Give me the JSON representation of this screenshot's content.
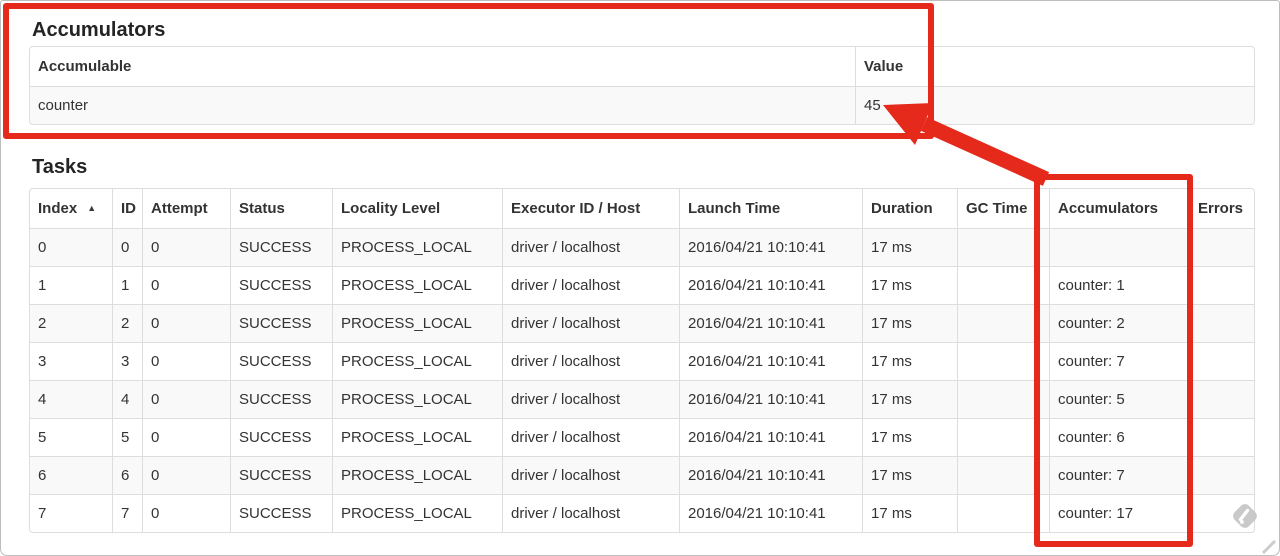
{
  "colors": {
    "annotation_red": "#e5291b",
    "row_stripe": "#f9f9f9",
    "table_border": "#dddddd",
    "text": "#333333"
  },
  "accumulators_section": {
    "heading": "Accumulators",
    "columns": [
      "Accumulable",
      "Value"
    ],
    "rows": [
      {
        "accumulable": "counter",
        "value": "45"
      }
    ]
  },
  "tasks_section": {
    "heading": "Tasks",
    "sort_indicator": "▲",
    "columns": [
      "Index",
      "ID",
      "Attempt",
      "Status",
      "Locality Level",
      "Executor ID / Host",
      "Launch Time",
      "Duration",
      "GC Time",
      "Accumulators",
      "Errors"
    ],
    "rows": [
      {
        "index": "0",
        "id": "0",
        "attempt": "0",
        "status": "SUCCESS",
        "locality_level": "PROCESS_LOCAL",
        "executor_id_host": "driver / localhost",
        "launch_time": "2016/04/21 10:10:41",
        "duration": "17 ms",
        "gc_time": "",
        "accumulators": "",
        "errors": ""
      },
      {
        "index": "1",
        "id": "1",
        "attempt": "0",
        "status": "SUCCESS",
        "locality_level": "PROCESS_LOCAL",
        "executor_id_host": "driver / localhost",
        "launch_time": "2016/04/21 10:10:41",
        "duration": "17 ms",
        "gc_time": "",
        "accumulators": "counter: 1",
        "errors": ""
      },
      {
        "index": "2",
        "id": "2",
        "attempt": "0",
        "status": "SUCCESS",
        "locality_level": "PROCESS_LOCAL",
        "executor_id_host": "driver / localhost",
        "launch_time": "2016/04/21 10:10:41",
        "duration": "17 ms",
        "gc_time": "",
        "accumulators": "counter: 2",
        "errors": ""
      },
      {
        "index": "3",
        "id": "3",
        "attempt": "0",
        "status": "SUCCESS",
        "locality_level": "PROCESS_LOCAL",
        "executor_id_host": "driver / localhost",
        "launch_time": "2016/04/21 10:10:41",
        "duration": "17 ms",
        "gc_time": "",
        "accumulators": "counter: 7",
        "errors": ""
      },
      {
        "index": "4",
        "id": "4",
        "attempt": "0",
        "status": "SUCCESS",
        "locality_level": "PROCESS_LOCAL",
        "executor_id_host": "driver / localhost",
        "launch_time": "2016/04/21 10:10:41",
        "duration": "17 ms",
        "gc_time": "",
        "accumulators": "counter: 5",
        "errors": ""
      },
      {
        "index": "5",
        "id": "5",
        "attempt": "0",
        "status": "SUCCESS",
        "locality_level": "PROCESS_LOCAL",
        "executor_id_host": "driver / localhost",
        "launch_time": "2016/04/21 10:10:41",
        "duration": "17 ms",
        "gc_time": "",
        "accumulators": "counter: 6",
        "errors": ""
      },
      {
        "index": "6",
        "id": "6",
        "attempt": "0",
        "status": "SUCCESS",
        "locality_level": "PROCESS_LOCAL",
        "executor_id_host": "driver / localhost",
        "launch_time": "2016/04/21 10:10:41",
        "duration": "17 ms",
        "gc_time": "",
        "accumulators": "counter: 7",
        "errors": ""
      },
      {
        "index": "7",
        "id": "7",
        "attempt": "0",
        "status": "SUCCESS",
        "locality_level": "PROCESS_LOCAL",
        "executor_id_host": "driver / localhost",
        "launch_time": "2016/04/21 10:10:41",
        "duration": "17 ms",
        "gc_time": "",
        "accumulators": "counter: 17",
        "errors": ""
      }
    ]
  },
  "icons": {
    "watermark": "feedly-diamond-icon"
  }
}
